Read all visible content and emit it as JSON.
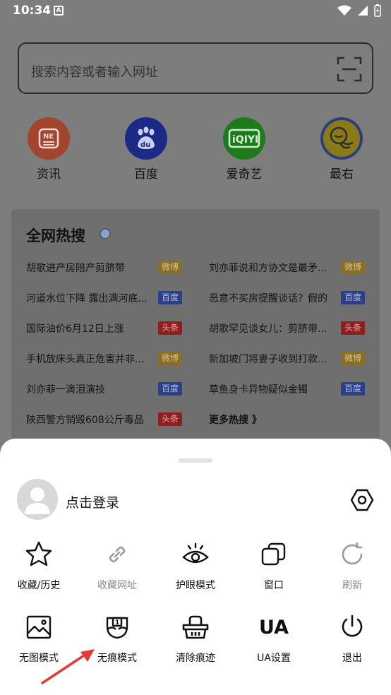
{
  "status_bar": {
    "time": "10:34",
    "notif_glyph": "A"
  },
  "search": {
    "placeholder": "搜索内容或者输入网址",
    "scan_icon": "scan-icon"
  },
  "shortcuts": [
    {
      "label": "资讯",
      "color": "#a3452e"
    },
    {
      "label": "百度",
      "color": "#1c2a85"
    },
    {
      "label": "爱奇艺",
      "color": "#1f7a1c"
    },
    {
      "label": "最右",
      "color": "#8b7a1a"
    }
  ],
  "hot_search": {
    "title": "全网热搜",
    "items": [
      {
        "text": "胡歌进产房陪产剪脐带",
        "tag": "微博"
      },
      {
        "text": "刘亦菲说和方协文是最矛...",
        "tag": "微博"
      },
      {
        "text": "河道水位下降 露出满河底...",
        "tag": "百度"
      },
      {
        "text": "恶意不买房提醒谈话？假的",
        "tag": "百度"
      },
      {
        "text": "国际油价6月12日上涨",
        "tag": "头条"
      },
      {
        "text": "胡歌罕见谈女儿：剪脐带...",
        "tag": "头条"
      },
      {
        "text": "手机放床头真正危害并非...",
        "tag": "微博"
      },
      {
        "text": "新加坡门将妻子收到打款...",
        "tag": "微博"
      },
      {
        "text": "刘亦菲一滴泪演技",
        "tag": "百度"
      },
      {
        "text": "草鱼身卡异物疑似金镯",
        "tag": "百度"
      },
      {
        "text": "陕西警方销毁608公斤毒品",
        "tag": "头条"
      }
    ],
    "more": "更多热搜 》"
  },
  "menu": {
    "login": "点击登录",
    "row1": [
      {
        "label": "收藏/历史",
        "icon": "star-icon",
        "enabled": true
      },
      {
        "label": "收藏网址",
        "icon": "link-icon",
        "enabled": false
      },
      {
        "label": "护眼模式",
        "icon": "eye-icon",
        "enabled": true
      },
      {
        "label": "窗口",
        "icon": "windows-icon",
        "enabled": true
      },
      {
        "label": "刷新",
        "icon": "refresh-icon",
        "enabled": false
      }
    ],
    "row2": [
      {
        "label": "无图模式",
        "icon": "image-icon",
        "enabled": true
      },
      {
        "label": "无痕模式",
        "icon": "incognito-mask-icon",
        "enabled": true,
        "mask_number": "1"
      },
      {
        "label": "清除痕迹",
        "icon": "basket-icon",
        "enabled": true
      },
      {
        "label": "UA设置",
        "icon": "ua-icon",
        "enabled": true,
        "glyph": "UA"
      },
      {
        "label": "退出",
        "icon": "power-icon",
        "enabled": true
      }
    ]
  },
  "colors": {
    "accent_arrow": "#e53935",
    "overlay": "#7d7d7d"
  }
}
